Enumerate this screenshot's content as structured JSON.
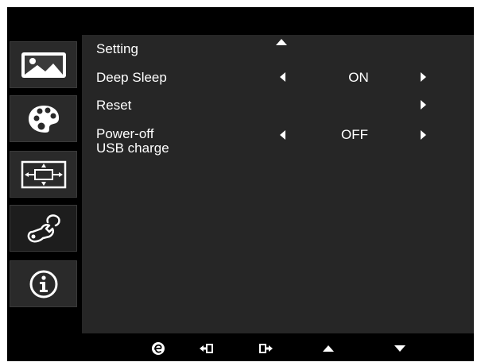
{
  "menu": {
    "title": "Setting"
  },
  "sidebar": {
    "items": [
      {
        "name": "picture",
        "icon": "picture-icon"
      },
      {
        "name": "color",
        "icon": "palette-icon"
      },
      {
        "name": "display",
        "icon": "display-position-icon"
      },
      {
        "name": "setting",
        "icon": "wrench-icon",
        "active": true
      },
      {
        "name": "information",
        "icon": "info-icon"
      }
    ]
  },
  "settings": {
    "deep_sleep": {
      "label": "Deep Sleep",
      "value": "ON"
    },
    "reset": {
      "label": "Reset"
    },
    "power_off_usb": {
      "label_line1": "Power-off",
      "label_line2": "USB charge",
      "value": "OFF"
    }
  },
  "footer": {
    "buttons": [
      "empowering-icon",
      "enter-icon",
      "exit-icon",
      "up-icon",
      "down-icon"
    ]
  }
}
